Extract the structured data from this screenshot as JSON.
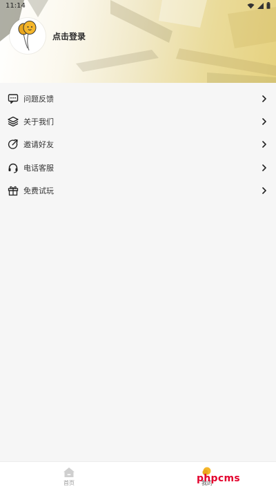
{
  "status_bar": {
    "time": "11:14"
  },
  "profile": {
    "login_text": "点击登录"
  },
  "menu": {
    "items": [
      {
        "label": "问题反馈",
        "icon": "message-dots-icon"
      },
      {
        "label": "关于我们",
        "icon": "layers-icon"
      },
      {
        "label": "邀请好友",
        "icon": "share-circle-icon"
      },
      {
        "label": "电话客服",
        "icon": "headset-icon"
      },
      {
        "label": "免费试玩",
        "icon": "gift-icon"
      }
    ]
  },
  "bottom_nav": {
    "tabs": [
      {
        "label": "首页",
        "icon": "home-icon"
      },
      {
        "label": "我的",
        "icon": "profile-balloon-icon"
      }
    ]
  },
  "watermark": "phpcms",
  "colors": {
    "accent": "#f5b62a",
    "background": "#f6f6f6",
    "watermark": "#e3002d"
  }
}
